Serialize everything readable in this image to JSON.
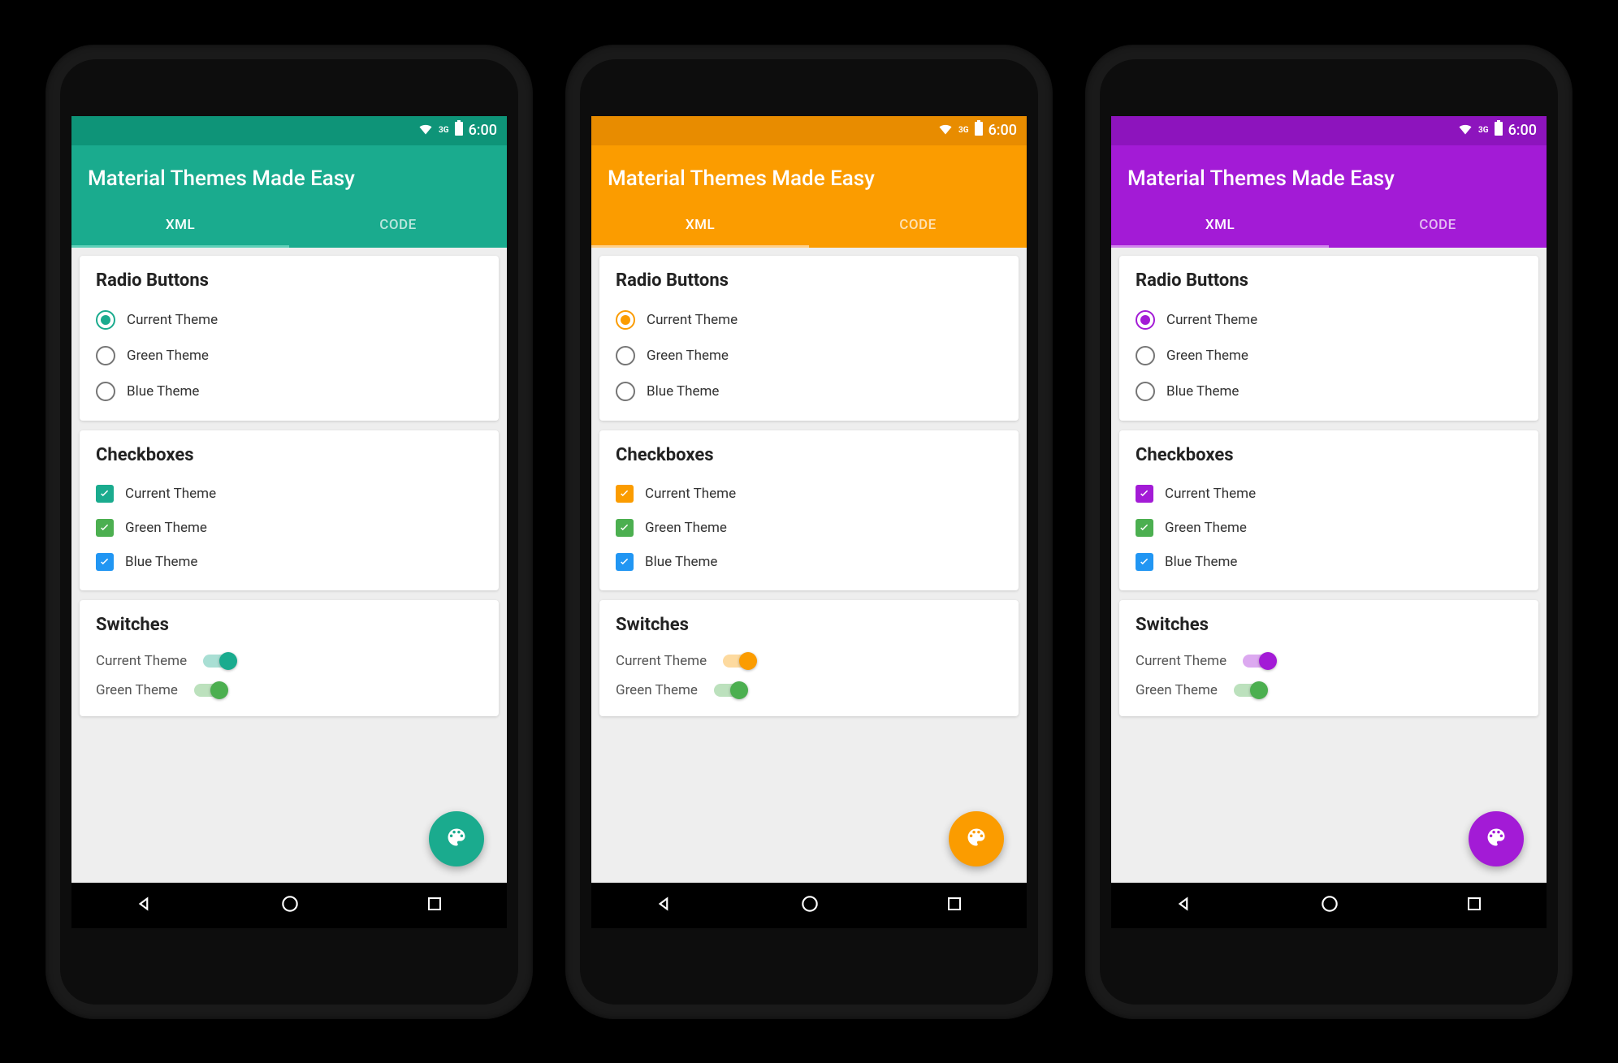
{
  "status": {
    "time": "6:00",
    "network_label": "3G"
  },
  "app_title": "Material Themes Made Easy",
  "tabs": {
    "xml": "XML",
    "code": "CODE"
  },
  "sections": {
    "radio_title": "Radio Buttons",
    "checkbox_title": "Checkboxes",
    "switch_title": "Switches",
    "items": {
      "current": "Current Theme",
      "green": "Green Theme",
      "blue": "Blue Theme"
    }
  },
  "colors": {
    "green_theme": "#4caf50",
    "blue_theme": "#2196f3"
  },
  "phones": [
    {
      "id": "teal",
      "primary": "#1aab8e",
      "primary_dark": "#0e9478",
      "tab_indicator": "#5ed0b8"
    },
    {
      "id": "orange",
      "primary": "#fb9c00",
      "primary_dark": "#e88c00",
      "tab_indicator": "#ffd08a"
    },
    {
      "id": "purple",
      "primary": "#a31bd6",
      "primary_dark": "#8d14bd",
      "tab_indicator": "#d083ec"
    }
  ]
}
